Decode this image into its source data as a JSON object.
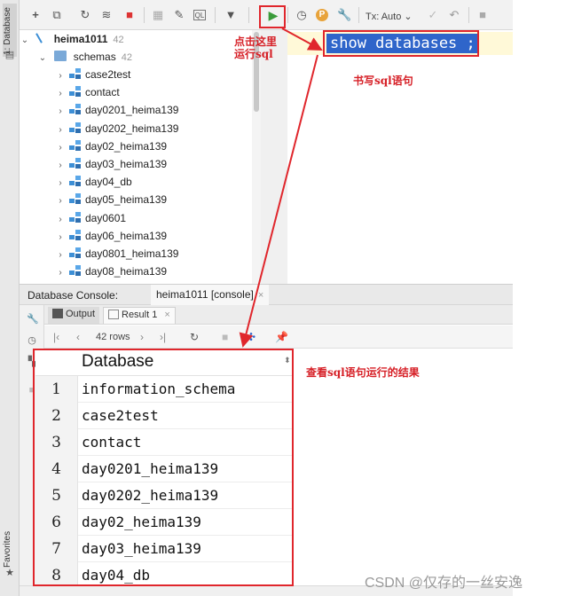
{
  "sidebar": {
    "database_tab": "1: Database",
    "favorites_tab": "Favorites"
  },
  "toolbar": {
    "tx_mode": "Tx: Auto",
    "icons": [
      "add-icon",
      "duplicate-icon",
      "refresh-icon",
      "edit-schema-icon",
      "stop-icon",
      "table-icon",
      "edit-icon",
      "sql-icon",
      "filter-icon",
      "run-icon",
      "history-icon",
      "p-icon",
      "wrench-icon",
      "commit-icon",
      "rollback-icon",
      "stop-icon"
    ]
  },
  "tree": {
    "connection": {
      "label": "heima1011",
      "count": "42"
    },
    "schemas": {
      "label": "schemas",
      "count": "42"
    },
    "items": [
      "case2test",
      "contact",
      "day0201_heima139",
      "day0202_heima139",
      "day02_heima139",
      "day03_heima139",
      "day04_db",
      "day05_heima139",
      "day0601",
      "day06_heima139",
      "day0801_heima139",
      "day08_heima139"
    ]
  },
  "editor": {
    "sql": "show databases ;"
  },
  "console": {
    "label": "Database Console:",
    "tab": "heima1011 [console]",
    "tab_close": "×"
  },
  "output_tabs": {
    "output": "Output",
    "result": "Result 1",
    "result_close": "×"
  },
  "result_toolbar": {
    "rows": "42 rows"
  },
  "grid": {
    "header": "Database",
    "rows": [
      {
        "num": "1",
        "value": "information_schema"
      },
      {
        "num": "2",
        "value": "case2test"
      },
      {
        "num": "3",
        "value": "contact"
      },
      {
        "num": "4",
        "value": "day0201_heima139"
      },
      {
        "num": "5",
        "value": "day0202_heima139"
      },
      {
        "num": "6",
        "value": "day02_heima139"
      },
      {
        "num": "7",
        "value": "day03_heima139"
      },
      {
        "num": "8",
        "value": "day04_db"
      }
    ]
  },
  "annotations": {
    "click_here": "点击这里\n运行sql",
    "write_sql": "书写sql语句",
    "view_result": "查看sql语句运行的结果"
  },
  "watermark": "CSDN @仅存的一丝安逸",
  "colors": {
    "annotation_red": "#e0262c",
    "selection_blue": "#2f65ca",
    "run_green": "#3a9b3a"
  }
}
